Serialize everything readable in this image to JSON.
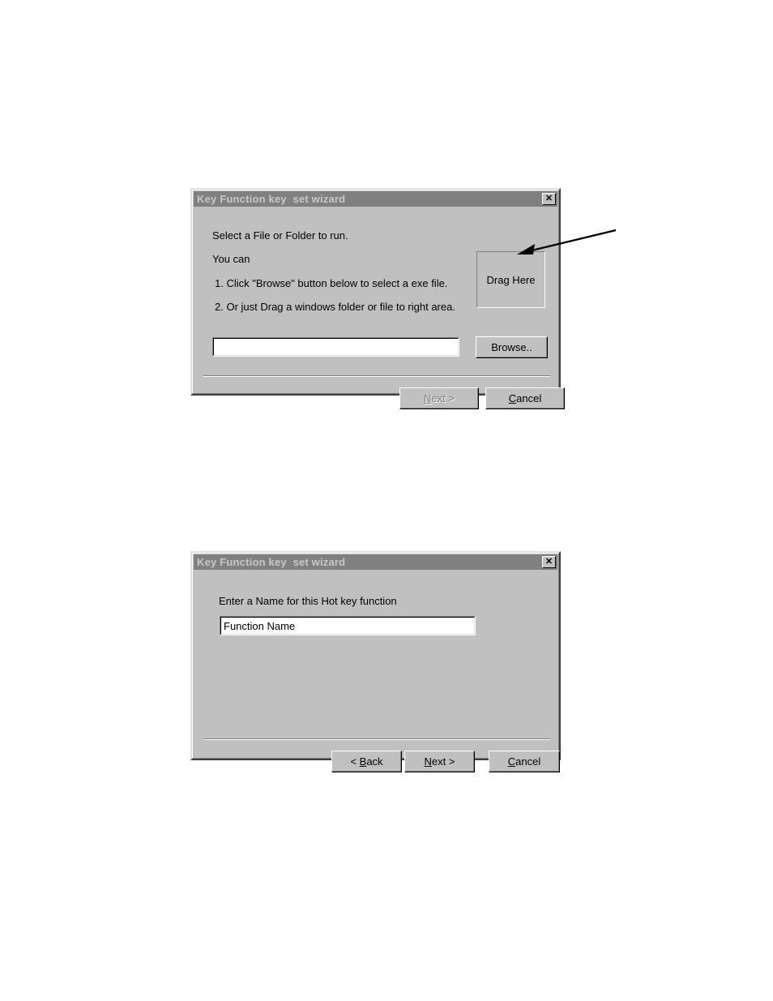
{
  "page": {
    "background_color": "#ffffff",
    "dialog_face_color": "#c0c0c0",
    "titlebar_color": "#808080",
    "titlebar_text_color": "#c8c8c8"
  },
  "dialog1": {
    "title": "Key Function key  set wizard",
    "close_icon": "close-icon",
    "close_label": "✕",
    "lines": [
      "Select a File or Folder to run.",
      "You can",
      "1. Click \"Browse\" button below to select a exe file.",
      "2. Or just Drag a windows folder or file to right area."
    ],
    "dropzone": {
      "label": "Drag Here"
    },
    "path_input": {
      "value": "",
      "placeholder": ""
    },
    "buttons": {
      "browse": {
        "label": "Browse..",
        "accel": "",
        "disabled": false
      },
      "next": {
        "label": "Next >",
        "accel": "N",
        "disabled": true
      },
      "cancel": {
        "label": "Cancel",
        "accel": "C",
        "disabled": false
      }
    },
    "annotation": {
      "type": "arrow",
      "points_to": "drag-here-dropzone"
    }
  },
  "dialog2": {
    "title": "Key Function key  set wizard",
    "close_icon": "close-icon",
    "close_label": "✕",
    "label": "Enter a Name for this Hot key function",
    "name_input": {
      "value": "Function Name",
      "placeholder": ""
    },
    "buttons": {
      "back": {
        "label": "< Back",
        "accel": "B",
        "disabled": false
      },
      "next": {
        "label": "Next >",
        "accel": "N",
        "disabled": false
      },
      "cancel": {
        "label": "Cancel",
        "accel": "C",
        "disabled": false
      }
    }
  }
}
